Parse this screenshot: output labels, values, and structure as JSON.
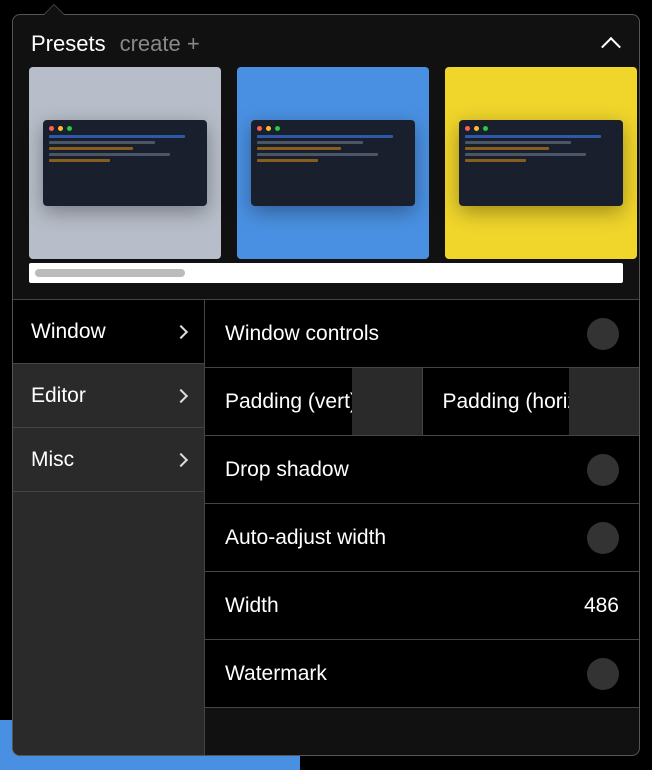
{
  "presets": {
    "title": "Presets",
    "create_label": "create +",
    "thumbs": [
      {
        "bg": "#b8bec9"
      },
      {
        "bg": "#4a90e2"
      },
      {
        "bg": "#f0d52b"
      }
    ]
  },
  "sidebar": {
    "items": [
      {
        "label": "Window",
        "active": true
      },
      {
        "label": "Editor",
        "active": false
      },
      {
        "label": "Misc",
        "active": false
      }
    ]
  },
  "settings": {
    "window_controls": {
      "label": "Window controls"
    },
    "padding_vert": {
      "label": "Padding (vert)"
    },
    "padding_horiz": {
      "label": "Padding (horiz)"
    },
    "drop_shadow": {
      "label": "Drop shadow"
    },
    "auto_adjust": {
      "label": "Auto-adjust width"
    },
    "width": {
      "label": "Width",
      "value": "486"
    },
    "watermark": {
      "label": "Watermark"
    }
  }
}
